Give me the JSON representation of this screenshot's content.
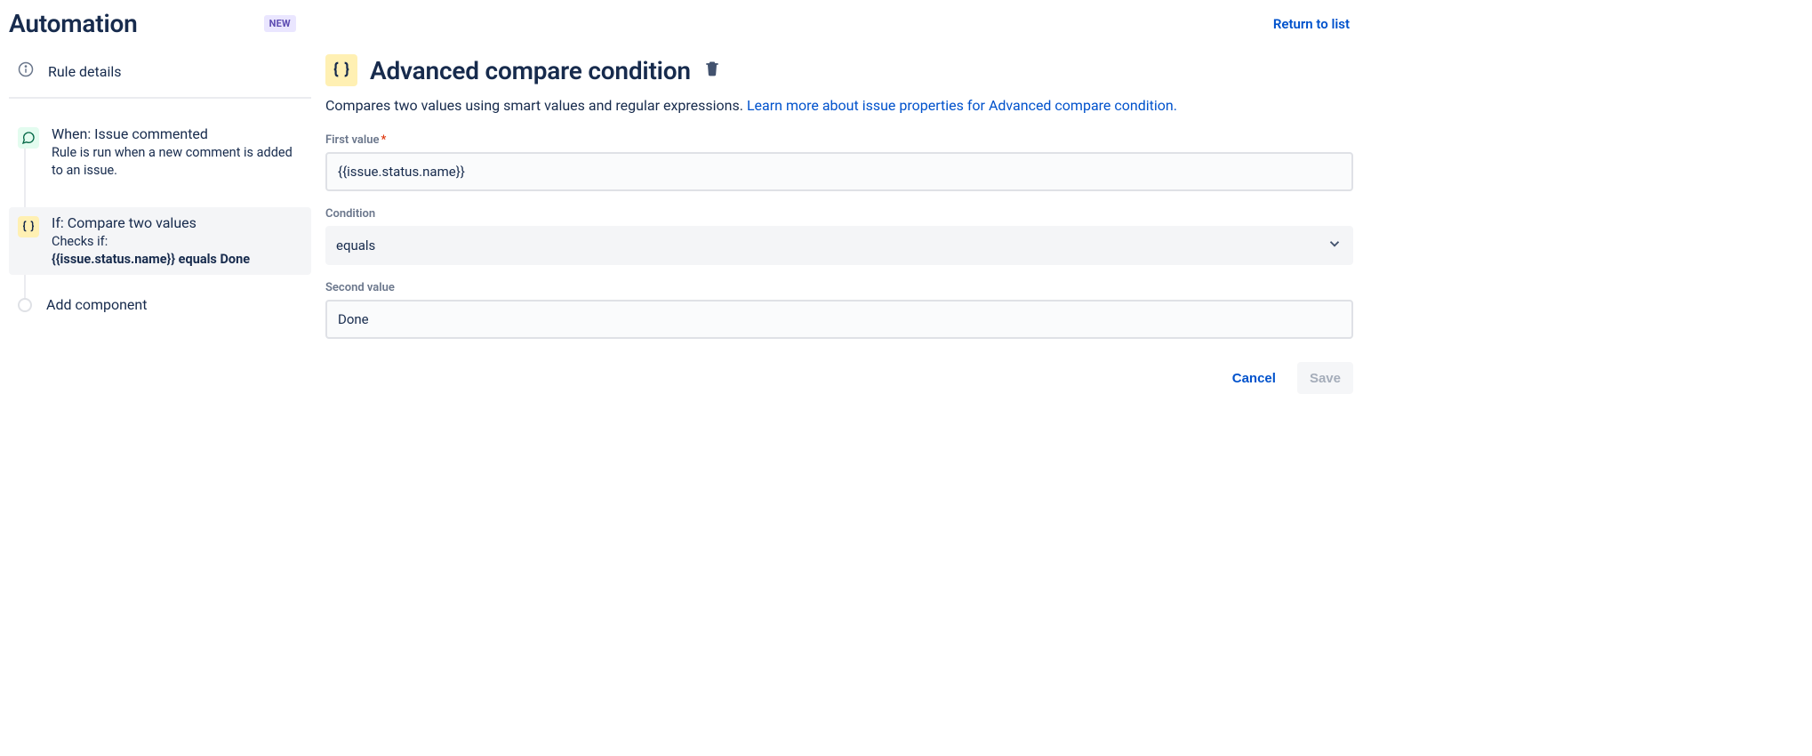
{
  "header": {
    "title": "Automation",
    "badge": "NEW",
    "return_link": "Return to list"
  },
  "sidebar": {
    "rule_details_label": "Rule details",
    "steps": {
      "trigger": {
        "title": "When: Issue commented",
        "desc": "Rule is run when a new comment is added to an issue."
      },
      "condition": {
        "title": "If: Compare two values",
        "desc_prefix": "Checks if:",
        "desc_bold": "{{issue.status.name}} equals Done"
      }
    },
    "add_component_label": "Add component"
  },
  "main": {
    "title": "Advanced compare condition",
    "desc_text": "Compares two values using smart values and regular expressions. ",
    "desc_link": "Learn more about issue properties for Advanced compare condition.",
    "fields": {
      "first_value_label": "First value",
      "first_value": "{{issue.status.name}}",
      "condition_label": "Condition",
      "condition_value": "equals",
      "second_value_label": "Second value",
      "second_value": "Done"
    },
    "buttons": {
      "cancel": "Cancel",
      "save": "Save"
    }
  }
}
